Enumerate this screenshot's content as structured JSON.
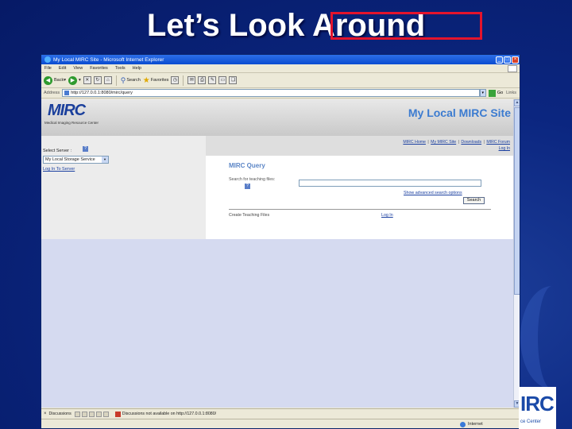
{
  "slide": {
    "title": "Let’s Look Around"
  },
  "corner_logo": {
    "text": "IRC",
    "sub": "ce Center"
  },
  "browser": {
    "window_title": "My Local MIRC Site - Microsoft Internet Explorer",
    "menu": [
      "File",
      "Edit",
      "View",
      "Favorites",
      "Tools",
      "Help"
    ],
    "toolbar": {
      "back": "Back",
      "search": "Search",
      "favorites": "Favorites"
    },
    "address_label": "Address",
    "address_url": "http://127.0.0.1:8080/mirc/query",
    "go_label": "Go",
    "links_label": "Links"
  },
  "site": {
    "logo": "MIRC",
    "logo_sub": "Medical Imaging Resource Center",
    "title": "My Local MIRC Site",
    "nav": {
      "home": "MIRC Home",
      "my_site": "My MIRC Site",
      "downloads": "Downloads",
      "forum": "MIRC Forum",
      "login": "Log In"
    },
    "select_server_label": "Select Server :",
    "server_value": "My Local Storage Service",
    "login_to_server": "Log In To Server",
    "query_title": "MIRC Query",
    "search_label": "Search for teaching files:",
    "advanced_link": "Show advanced search options",
    "search_button": "Search",
    "create_label": "Create Teaching Files",
    "create_login": "Log In"
  },
  "status": {
    "discussions": "Discussions",
    "message": "Discussions not available on http://127.0.0.1:8080/",
    "zone": "Internet"
  }
}
